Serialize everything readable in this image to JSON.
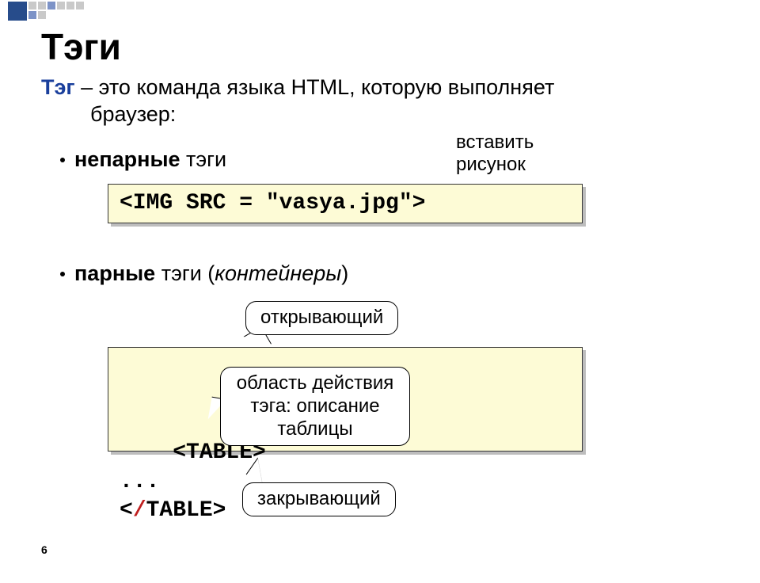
{
  "title": "Тэги",
  "definition": {
    "term": "Тэг",
    "rest_line1": " – это команда языка HTML, которую выполняет",
    "rest_line2": "браузер:"
  },
  "bullets": {
    "unpaired_strong": "непарные",
    "unpaired_rest": " тэги",
    "paired_strong": "парные",
    "paired_rest": " тэги (",
    "paired_ital": "контейнеры",
    "paired_close": ")"
  },
  "code1": "<IMG SRC = \"vasya.jpg\">",
  "code2": {
    "open": "<TABLE>",
    "mid": "...",
    "close_pre": "<",
    "close_slash": "/",
    "close_post": "TABLE>"
  },
  "callouts": {
    "insert": "вставить\nрисунок",
    "open": "открывающий",
    "area": "область действия\nтэга: описание\nтаблицы",
    "close": "закрывающий"
  },
  "page_number": "6"
}
